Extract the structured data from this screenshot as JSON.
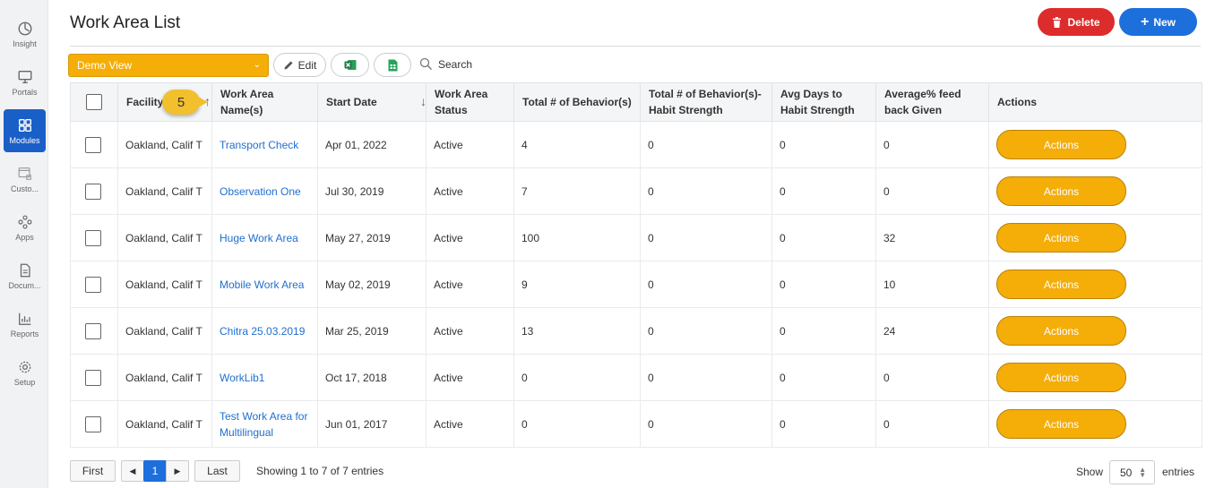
{
  "sidebar": {
    "items": [
      {
        "label": "Insight",
        "icon": "insight-icon"
      },
      {
        "label": "Portals",
        "icon": "monitor-icon"
      },
      {
        "label": "Modules",
        "icon": "grid-icon",
        "active": true
      },
      {
        "label": "Custo...",
        "icon": "custom-window-icon"
      },
      {
        "label": "Apps",
        "icon": "apps-icon"
      },
      {
        "label": "Docum...",
        "icon": "document-icon"
      },
      {
        "label": "Reports",
        "icon": "chart-icon"
      },
      {
        "label": "Setup",
        "icon": "gear-icon"
      }
    ]
  },
  "header": {
    "title": "Work Area List",
    "delete_label": "Delete",
    "new_label": "New"
  },
  "toolbar": {
    "view_value": "Demo View",
    "edit_label": "Edit",
    "search_label": "Search"
  },
  "table": {
    "columns": [
      "Facility",
      "Work Area Name(s)",
      "Start Date",
      "Work Area Status",
      "Total # of Behavior(s)",
      "Total # of Behavior(s)-Habit Strength",
      "Avg Days to Habit Strength",
      "Average% feed back Given",
      "Actions"
    ],
    "badge": "5",
    "action_label": "Actions",
    "rows": [
      {
        "facility": "Oakland, Calif T",
        "name": "Transport Check",
        "start": "Apr 01, 2022",
        "status": "Active",
        "total": "4",
        "habit": "0",
        "avg_days": "0",
        "feedback": "0"
      },
      {
        "facility": "Oakland, Calif T",
        "name": "Observation One",
        "start": "Jul 30, 2019",
        "status": "Active",
        "total": "7",
        "habit": "0",
        "avg_days": "0",
        "feedback": "0"
      },
      {
        "facility": "Oakland, Calif T",
        "name": "Huge Work Area",
        "start": "May 27, 2019",
        "status": "Active",
        "total": "100",
        "habit": "0",
        "avg_days": "0",
        "feedback": "32"
      },
      {
        "facility": "Oakland, Calif T",
        "name": "Mobile Work Area",
        "start": "May 02, 2019",
        "status": "Active",
        "total": "9",
        "habit": "0",
        "avg_days": "0",
        "feedback": "10"
      },
      {
        "facility": "Oakland, Calif T",
        "name": "Chitra 25.03.2019",
        "start": "Mar 25, 2019",
        "status": "Active",
        "total": "13",
        "habit": "0",
        "avg_days": "0",
        "feedback": "24"
      },
      {
        "facility": "Oakland, Calif T",
        "name": "WorkLib1",
        "start": "Oct 17, 2018",
        "status": "Active",
        "total": "0",
        "habit": "0",
        "avg_days": "0",
        "feedback": "0"
      },
      {
        "facility": "Oakland, Calif T",
        "name": "Test Work Area for Multilingual",
        "start": "Jun 01, 2017",
        "status": "Active",
        "total": "0",
        "habit": "0",
        "avg_days": "0",
        "feedback": "0"
      }
    ]
  },
  "pagination": {
    "first_label": "First",
    "current_page": "1",
    "last_label": "Last",
    "showing_text": "Showing 1 to 7 of 7 entries",
    "show_label": "Show",
    "page_size": "50",
    "entries_label": "entries"
  },
  "colors": {
    "accent_orange": "#f5ad08",
    "primary_blue": "#1d6fdb",
    "danger_red": "#dd2c2c",
    "link_blue": "#1f6fd0"
  }
}
